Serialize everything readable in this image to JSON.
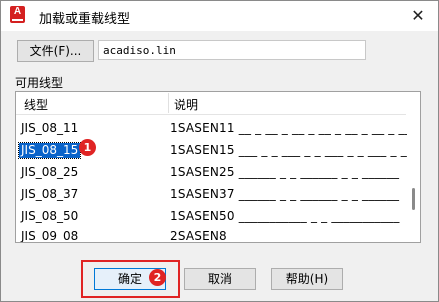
{
  "window": {
    "title": "加载或重载线型",
    "close_symbol": "✕",
    "app_icon_letter": "A"
  },
  "file": {
    "button_label": "文件(F)...",
    "path": "acadiso.lin"
  },
  "list": {
    "section_label": "可用线型",
    "columns": [
      "线型",
      "说明"
    ],
    "rows": [
      {
        "name": "JIS_08_11",
        "desc": "1SASEN11 __ _ __ _ __ _ __ _ __ _ __ _ ___"
      },
      {
        "name": "JIS_08_15",
        "desc": "1SASEN15 ___ _ _ ___ _ _ ___ _ _ ___ _ _ ___",
        "selected": true
      },
      {
        "name": "JIS_08_25",
        "desc": "1SASEN25 ______ _ _ ______ _ _ ______"
      },
      {
        "name": "JIS_08_37",
        "desc": "1SASEN37 ______ _ _ ______ _ _ ______"
      },
      {
        "name": "JIS_08_50",
        "desc": "1SASEN50 ___________ _ _ ___________"
      },
      {
        "name": "JIS_09_08",
        "desc": "2SASEN8"
      }
    ]
  },
  "badges": {
    "step1": "1",
    "step2": "2"
  },
  "buttons": {
    "ok": "确定",
    "cancel": "取消",
    "help": "帮助(H)"
  }
}
